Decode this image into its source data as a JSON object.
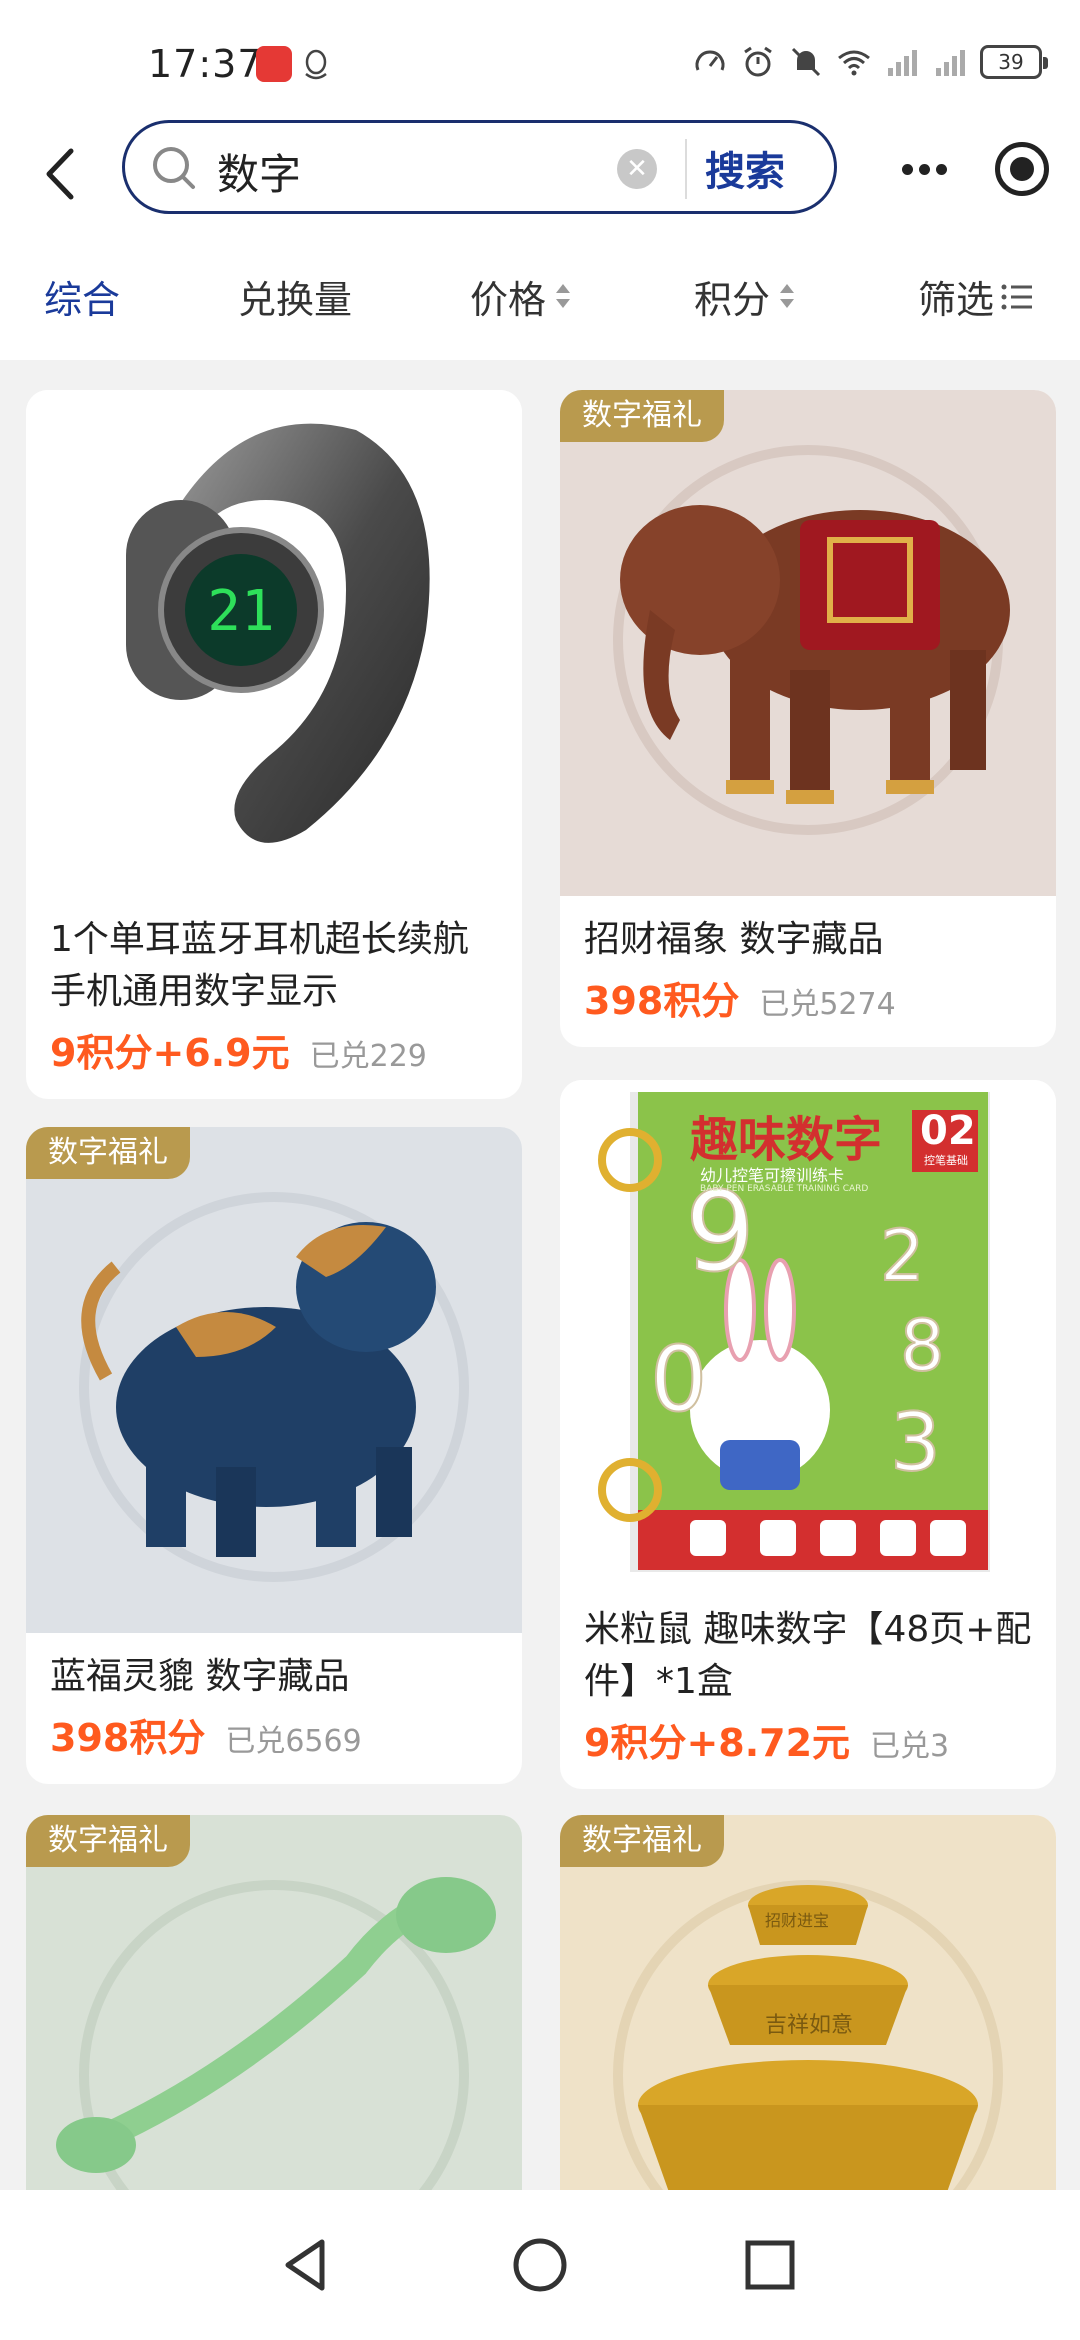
{
  "status_bar": {
    "time": "17:37",
    "battery": "39"
  },
  "header": {
    "search_query": "数字",
    "search_button": "搜索"
  },
  "filters": {
    "tabs": [
      "综合",
      "兑换量",
      "价格",
      "积分",
      "筛选"
    ],
    "active": "综合"
  },
  "products": [
    {
      "title": "1个单耳蓝牙耳机超长续航手机通用数字显示",
      "price": "9积分+6.9元",
      "sold": "已兑229",
      "badge": ""
    },
    {
      "title": "招财福象 数字藏品",
      "price": "398积分",
      "sold": "已兑5274",
      "badge": "数字福礼"
    },
    {
      "title": "蓝福灵貔 数字藏品",
      "price": "398积分",
      "sold": "已兑6569",
      "badge": "数字福礼"
    },
    {
      "title": "米粒鼠 趣味数字【48页+配件】*1盒",
      "price": "9积分+8.72元",
      "sold": "已兑3",
      "badge": ""
    },
    {
      "title": "",
      "price": "",
      "sold": "",
      "badge": "数字福礼"
    },
    {
      "title": "",
      "price": "",
      "sold": "",
      "badge": "数字福礼"
    }
  ],
  "book_cover": {
    "title": "趣味数字",
    "number": "02",
    "subtitle": "控笔基础",
    "tagline": "幼儿控笔可擦训练卡",
    "english": "BABY PEN ERASABLE TRAINING CARD"
  },
  "ingot_text": {
    "top": "招财进宝",
    "middle": "吉祥如意"
  }
}
